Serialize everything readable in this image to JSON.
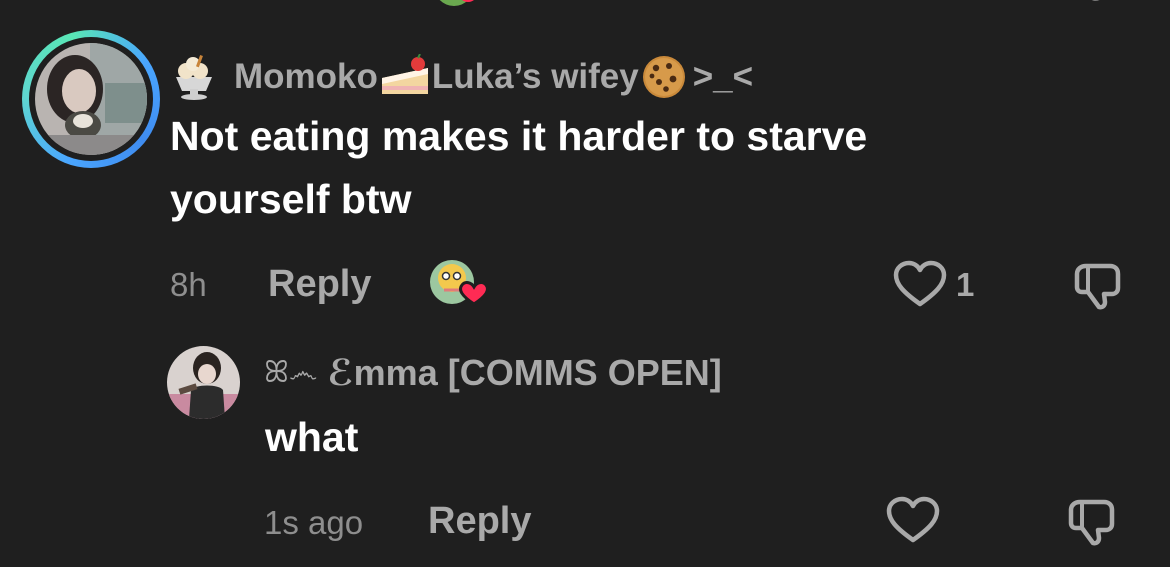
{
  "comments": [
    {
      "username_prefix_emoji": "ice-cream-icon",
      "username_part1": "Momoko",
      "username_emoji1": "cake-icon",
      "username_part2": " Luka’s wifey",
      "username_emoji2": "cookie-icon",
      "username_part3": ">_<",
      "text_line1": "Not eating makes it harder to starve",
      "text_line2": "yourself btw",
      "time": "8h",
      "reply_label": "Reply",
      "like_count": "1",
      "avatar_ring_colors": [
        "#4aa6ff",
        "#5fd7d0"
      ]
    },
    {
      "username_prefix": "ꕤ෴",
      "username": "ℰmma [COMMS OPEN]",
      "text": "what",
      "time": "1s ago",
      "reply_label": "Reply"
    }
  ],
  "colors": {
    "background": "#1f1f1f",
    "text_primary": "#ffffff",
    "text_secondary": "#a9a9a9",
    "heart_accent": "#ff2b54"
  }
}
